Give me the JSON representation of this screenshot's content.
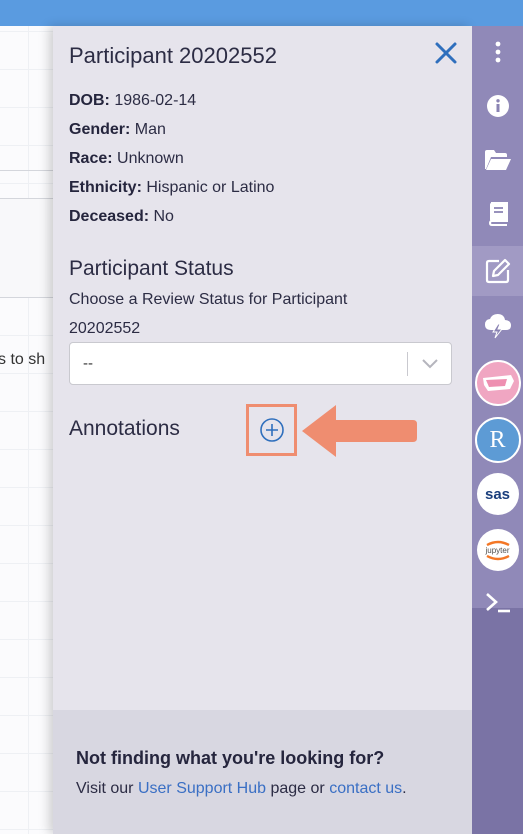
{
  "participant": {
    "title": "Participant 20202552",
    "fields": [
      {
        "label": "DOB:",
        "value": "1986-02-14"
      },
      {
        "label": "Gender:",
        "value": "Man"
      },
      {
        "label": "Race:",
        "value": "Unknown"
      },
      {
        "label": "Ethnicity:",
        "value": "Hispanic or Latino"
      },
      {
        "label": "Deceased:",
        "value": "No"
      }
    ]
  },
  "status": {
    "title": "Participant Status",
    "help": "Choose a Review Status for Participant 20202552",
    "select_value": "--"
  },
  "annotations": {
    "label": "Annotations"
  },
  "footer": {
    "title": "Not finding what you're looking for?",
    "text_prefix": "Visit our",
    "hub_link": "User Support Hub",
    "text_middle": "page or",
    "contact_link": "contact us",
    "text_suffix": "."
  },
  "background": {
    "partial_text": "s to sh"
  },
  "rail": {
    "icons": [
      "more-vertical-icon",
      "info-icon",
      "folder-open-icon",
      "book-icon",
      "edit-icon",
      "cloud-lightning-icon",
      "puerto-rico-icon",
      "r-language-icon",
      "sas-icon",
      "jupyter-icon",
      "terminal-icon"
    ],
    "r_label": "R",
    "sas_label": "sas",
    "jupyter_label": "jupyter"
  },
  "colors": {
    "top_bar": "#5a9be0",
    "drawer_bg": "#e6e4ec",
    "rail_bg": "#9089b8",
    "highlight": "#ef8d70",
    "link": "#3a6fc4"
  }
}
